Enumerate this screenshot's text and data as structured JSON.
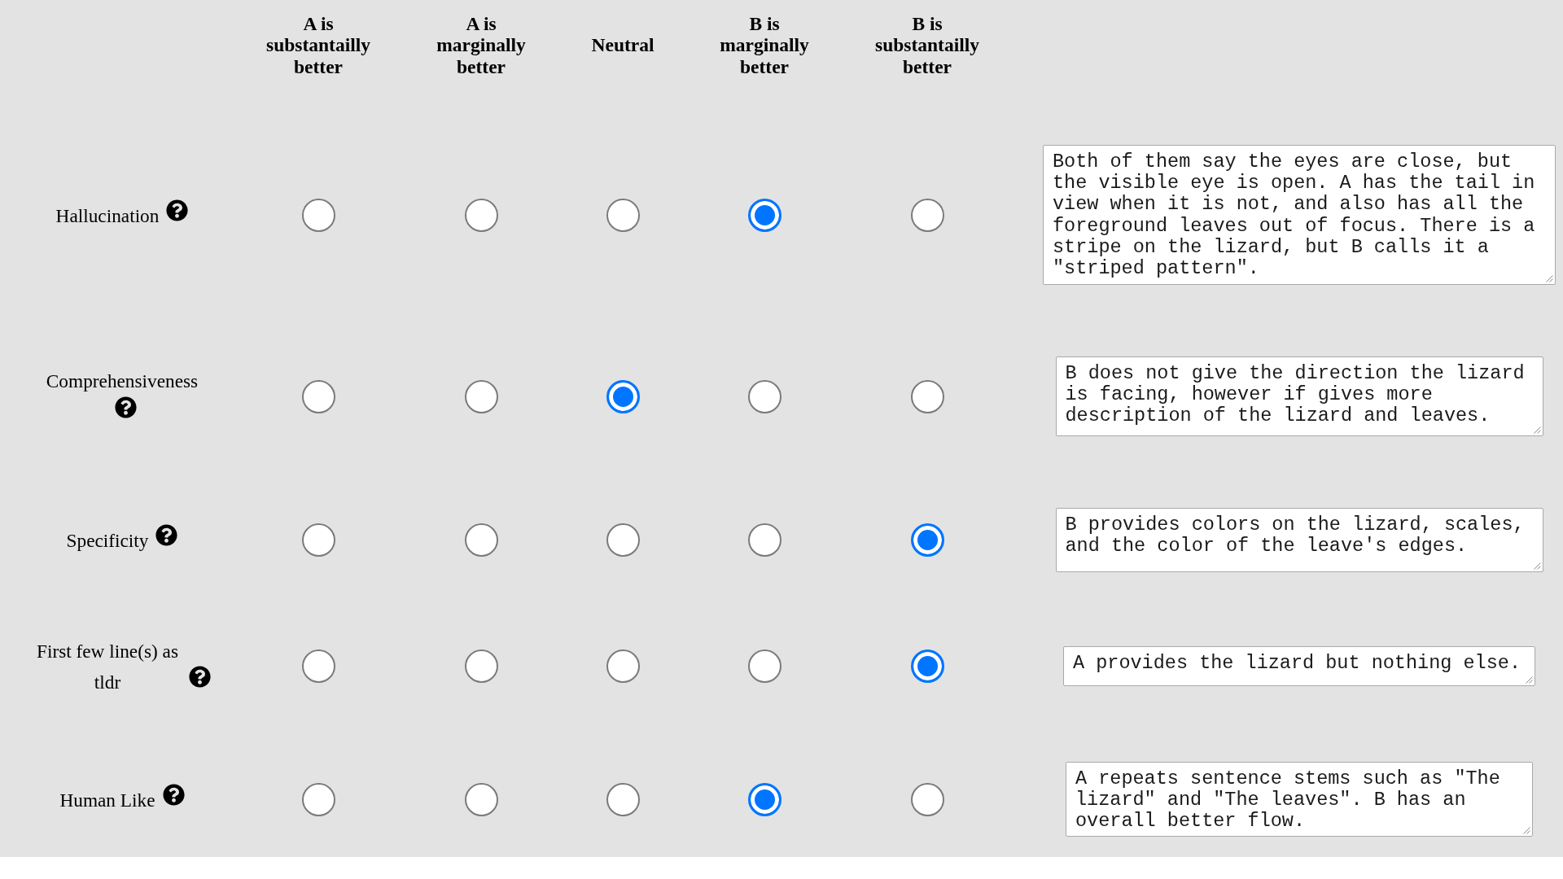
{
  "scale_headers": [
    "A is substantailly better",
    "A is marginally better",
    "Neutral",
    "B is marginally better",
    "B is substantailly better"
  ],
  "criteria": [
    {
      "label": "Hallucination",
      "choices": [
        {
          "selected": false
        },
        {
          "selected": false
        },
        {
          "selected": false
        },
        {
          "selected": true
        },
        {
          "selected": false
        }
      ],
      "comment": "Both of them say the eyes are close, but the visible eye is open. A has the tail in view when it is not, and also has all the foreground leaves out of focus. There is a stripe on the lizard, but B calls it a \"striped pattern\"."
    },
    {
      "label": "Comprehensiveness",
      "choices": [
        {
          "selected": false
        },
        {
          "selected": false
        },
        {
          "selected": true
        },
        {
          "selected": false
        },
        {
          "selected": false
        }
      ],
      "comment": "B does not give the direction the lizard is facing, however if gives more description of the lizard and leaves."
    },
    {
      "label": "Specificity",
      "choices": [
        {
          "selected": false
        },
        {
          "selected": false
        },
        {
          "selected": false
        },
        {
          "selected": false
        },
        {
          "selected": true
        }
      ],
      "comment": "B provides colors on the lizard, scales, and the color of the leave's edges."
    },
    {
      "label": "First few line(s) as tldr",
      "choices": [
        {
          "selected": false
        },
        {
          "selected": false
        },
        {
          "selected": false
        },
        {
          "selected": false
        },
        {
          "selected": true
        }
      ],
      "comment": "A provides the lizard but nothing else."
    },
    {
      "label": "Human Like",
      "choices": [
        {
          "selected": false
        },
        {
          "selected": false
        },
        {
          "selected": false
        },
        {
          "selected": true
        },
        {
          "selected": false
        }
      ],
      "comment": "A repeats sentence stems such as \"The lizard\" and \"The leaves\". B has an overall better flow."
    }
  ]
}
